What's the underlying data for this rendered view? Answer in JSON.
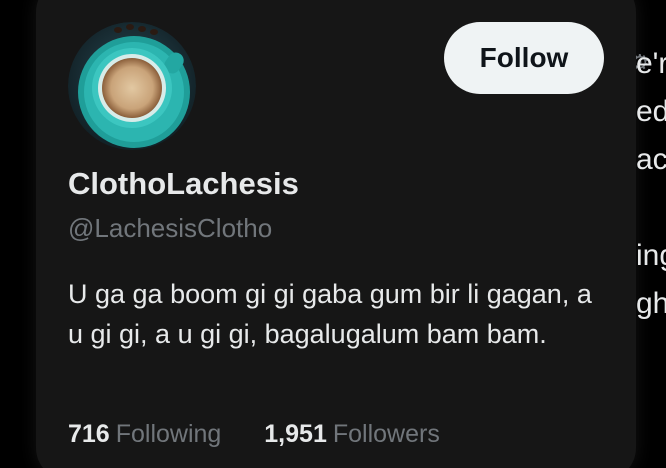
{
  "background": {
    "text_lines": [
      "e'r",
      "ed",
      "ac",
      "",
      "ing",
      "gh"
    ],
    "icon": "settings-icon"
  },
  "profile": {
    "display_name": "ClothoLachesis",
    "handle": "@LachesisClotho",
    "bio": "U ga ga boom gi gi gaba gum bir li gagan, a u gi gi, a u gi gi, bagalugalum bam bam.",
    "avatar": "coffee-cup-avatar"
  },
  "actions": {
    "follow_label": "Follow"
  },
  "stats": {
    "following_count": "716",
    "following_label": "Following",
    "followers_count": "1,951",
    "followers_label": "Followers"
  },
  "colors": {
    "background": "#000000",
    "card": "#161616",
    "text_primary": "#e7e9ea",
    "text_secondary": "#71767b",
    "button_bg": "#eff3f4",
    "button_text": "#0f1419",
    "avatar_teal": "#2cb5b0"
  }
}
